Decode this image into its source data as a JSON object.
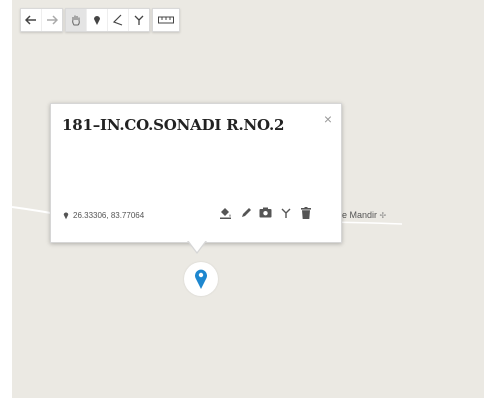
{
  "toolbar": {
    "icons": [
      "undo-icon",
      "redo-icon",
      "pan-hand-icon",
      "marker-icon",
      "polygon-icon",
      "branch-icon",
      "ruler-icon"
    ]
  },
  "map": {
    "label": "e Mandir",
    "label_glyph": "✢"
  },
  "popup": {
    "title": "181–IN.CO.SONADI R.NO.2",
    "close_label": "×",
    "coordinates": "26.33306, 83.77064",
    "actions": [
      "paint-bucket-icon",
      "pencil-icon",
      "camera-icon",
      "branch-icon",
      "trash-icon"
    ]
  },
  "colors": {
    "map_background": "#ebe9e3",
    "marker": "#1e87cf",
    "icon": "#555555"
  }
}
